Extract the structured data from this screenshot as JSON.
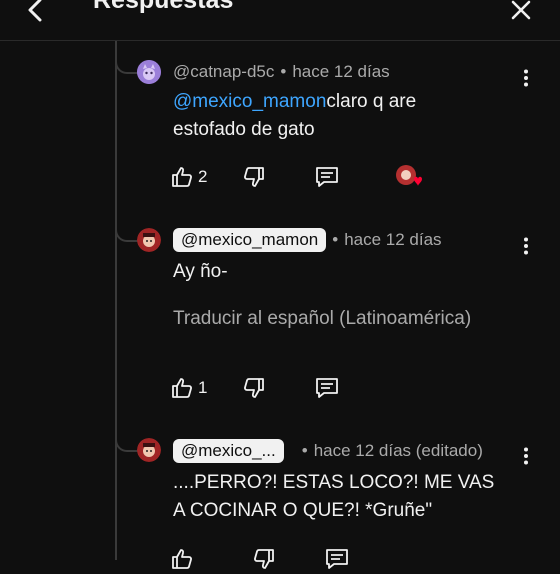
{
  "header": {
    "title": "Respuestas"
  },
  "comments": [
    {
      "handle": "@catnap-d5c",
      "time": "hace 12 días",
      "mention": "@mexico_mamon",
      "text": "claro q are",
      "text2": "estofado de gato",
      "likes": "2"
    },
    {
      "handle": "@mexico_mamon",
      "time": "hace 12 días",
      "text": "Ay ño-",
      "translate": "Traducir al español (Latinoamérica)",
      "likes": "1"
    },
    {
      "handle": "@mexico_...",
      "time": "hace 12 días (editado)",
      "text": "....PERRO?! ESTAS LOCO?! ME VAS",
      "text2": "A COCINAR O QUE?! *Gruñe\""
    }
  ],
  "icons": [
    "back-arrow-icon",
    "close-icon",
    "more-vert-icon",
    "thumbs-up-icon",
    "thumbs-down-icon",
    "reply-icon",
    "creator-heart-icon"
  ],
  "colors": {
    "mention": "#3ea6ff",
    "heart": "#ff0033",
    "background": "#0f0f0f"
  }
}
